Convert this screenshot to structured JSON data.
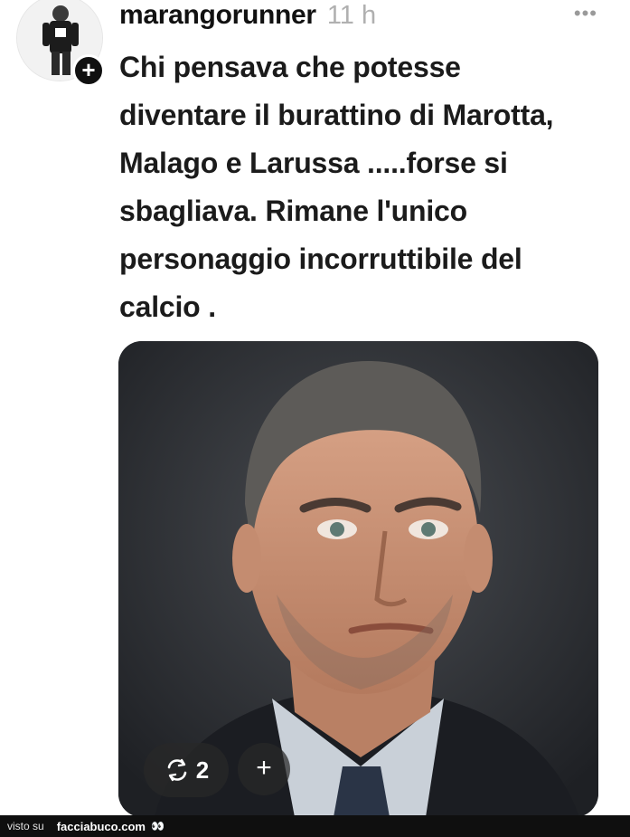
{
  "post": {
    "username": "marangorunner",
    "time": "11 h",
    "more_icon": "more-horizontal-icon",
    "follow_symbol": "+",
    "caption_lines": [
      "Chi pensava che potesse",
      "diventare il burattino di Marotta,",
      "Malago e Larussa .....forse si",
      "sbagliava. Rimane l'unico",
      "personaggio incorruttibile del",
      "calcio ."
    ],
    "media": {
      "repost_icon": "repost-icon",
      "repost_count": "2",
      "add_symbol": "+"
    }
  },
  "footer": {
    "via_label": "visto su",
    "brand": "facciabuco.com",
    "eyes": "👀"
  },
  "colors": {
    "text": "#1b1b1b",
    "muted": "#b0b0b0",
    "footer_bg": "#0f0f0f"
  }
}
